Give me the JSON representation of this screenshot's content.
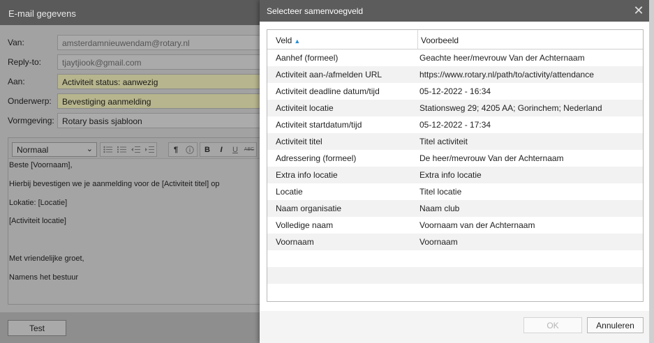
{
  "email_dialog": {
    "title": "E-mail gegevens",
    "fields": {
      "van": {
        "label": "Van:",
        "value": "amsterdamnieuwendam@rotary.nl"
      },
      "replyto": {
        "label": "Reply-to:",
        "value": "tjaytjiook@gmail.com"
      },
      "aan": {
        "label": "Aan:",
        "value": "Activiteit status: aanwezig"
      },
      "onderwerp": {
        "label": "Onderwerp:",
        "value": "Bevestiging aanmelding"
      },
      "vormgeving": {
        "label": "Vormgeving:",
        "value": "Rotary basis sjabloon"
      }
    },
    "editor": {
      "format_select": "Normaal",
      "toolbar_icons": [
        "bullet-list-icon",
        "numbered-list-icon",
        "outdent-icon",
        "indent-icon",
        "pilcrow-icon",
        "info-icon",
        "bold-icon",
        "italic-icon",
        "underline-icon",
        "strikethrough-icon"
      ],
      "bold_glyph": "B",
      "italic_glyph": "I",
      "underline_glyph": "U",
      "strike_glyph": "ABC",
      "pilcrow_glyph": "¶",
      "lines": [
        "Beste [Voornaam],",
        "Hierbij bevestigen we je aanmelding voor de [Activiteit titel] op",
        "Lokatie: [Locatie]",
        "[Activiteit locatie]",
        "Met vriendelijke groet,",
        "Namens het bestuur"
      ]
    },
    "test_button": "Test"
  },
  "merge_dialog": {
    "title": "Selecteer samenvoegveld",
    "close_glyph": "✕",
    "columns": {
      "field": "Veld",
      "example": "Voorbeeld",
      "sort_indicator": "▲"
    },
    "rows": [
      {
        "field": "Aanhef (formeel)",
        "example": "Geachte heer/mevrouw Van der Achternaam"
      },
      {
        "field": "Activiteit aan-/afmelden URL",
        "example": "https://www.rotary.nl/path/to/activity/attendance"
      },
      {
        "field": "Activiteit deadline datum/tijd",
        "example": "05-12-2022 - 16:34"
      },
      {
        "field": "Activiteit locatie",
        "example": "Stationsweg 29; 4205 AA; Gorinchem; Nederland"
      },
      {
        "field": "Activiteit startdatum/tijd",
        "example": "05-12-2022 - 17:34"
      },
      {
        "field": "Activiteit titel",
        "example": "Titel activiteit"
      },
      {
        "field": "Adressering (formeel)",
        "example": "De heer/mevrouw Van der Achternaam"
      },
      {
        "field": "Extra info locatie",
        "example": "Extra info locatie"
      },
      {
        "field": "Locatie",
        "example": "Titel locatie"
      },
      {
        "field": "Naam organisatie",
        "example": "Naam club"
      },
      {
        "field": "Volledige naam",
        "example": "Voornaam van der Achternaam"
      },
      {
        "field": "Voornaam",
        "example": "Voornaam"
      }
    ],
    "ok_button": "OK",
    "cancel_button": "Annuleren"
  },
  "colors": {
    "dialog_title_bg": "#5c5c5c",
    "sort_arrow": "#2a8fd6",
    "highlight_field": "#b7b58d"
  }
}
